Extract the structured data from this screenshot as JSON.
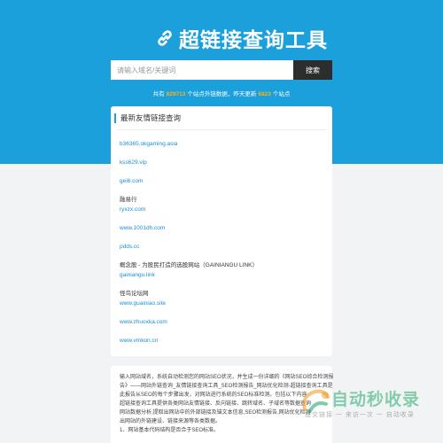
{
  "header": {
    "title": "超链接查询工具",
    "search_placeholder": "请输入域名/关键词",
    "search_button": "搜索",
    "stats": {
      "prefix": "共有",
      "total": "829713",
      "middle": "个站点外链数据，昨天更新",
      "updated": "6823",
      "suffix": "个站点"
    }
  },
  "list": {
    "title": "最新友情链接查询",
    "items": [
      {
        "title": "",
        "url": "b36365.okgaming.asia"
      },
      {
        "title": "",
        "url": "kss629.vip"
      },
      {
        "title": "",
        "url": "gei6.com"
      },
      {
        "title": "融易行",
        "url": "ryxzx.com"
      },
      {
        "title": "",
        "url": "www.1001dh.com"
      },
      {
        "title": "",
        "url": "pdds.cc"
      },
      {
        "title": "概念股 - 为股民打造的选股网站（GAINIANGU LINK）",
        "url": "gainiangu.link"
      },
      {
        "title": "怪鸟论坛网",
        "url": "www.guainiao.site"
      },
      {
        "title": "",
        "url": "www.zhuoxka.com"
      },
      {
        "title": "",
        "url": "www.vmkon.cn"
      }
    ]
  },
  "description": {
    "lines": [
      "输入网站域名，系统自动检测您的网站SEO状况，并生成一份详细的《网站SEO综合检测报",
      "告》——网站外链查询_友情链接查询工具_SEO检测报告_网站优化检测-超链接查询工具是",
      "此报告从SEO的每个步骤出发，对网站进行系统的SEO标准检测。包括以下内容",
      "超链接查询工具提供各类网站友情链接、反向链接、跳转域名、子域名等数据查询",
      "网站数据分析,提取出网站中的外部链接及锚文本信息,SEO检测报告,网站优化检测",
      "出网站的外链建设、链接来源等各类数据。",
      "1、网站基本代码结构是否合于SEO标准。"
    ]
  },
  "watermark": {
    "text": "自动秒收录",
    "sub": "提交链接 一 来访一次 一 自动收录"
  },
  "colors": {
    "hero": "#1ba0dc",
    "link": "#1a8fd6",
    "stat_number": "#f5b31a",
    "button": "#2d2d2d"
  }
}
